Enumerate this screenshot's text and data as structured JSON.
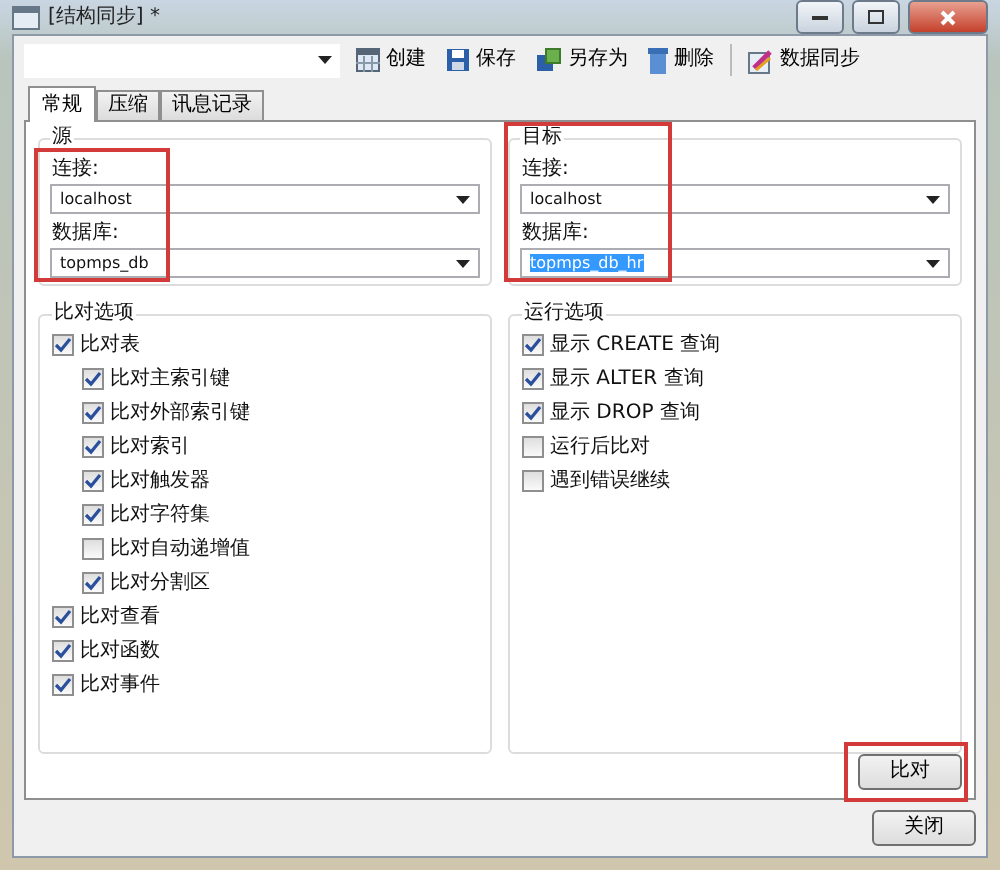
{
  "window": {
    "title": "[结构同步] *"
  },
  "toolbar": {
    "buttons": [
      {
        "label": "创建",
        "kind": "create"
      },
      {
        "label": "保存",
        "kind": "save"
      },
      {
        "label": "另存为",
        "kind": "saveas"
      },
      {
        "label": "删除",
        "kind": "delete"
      },
      {
        "label": "数据同步",
        "kind": "sync"
      }
    ]
  },
  "tabs": [
    {
      "label": "常规",
      "selected": true
    },
    {
      "label": "压缩",
      "selected": false
    },
    {
      "label": "讯息记录",
      "selected": false
    }
  ],
  "source": {
    "title": "源",
    "connection_label": "连接:",
    "connection": "localhost",
    "database_label": "数据库:",
    "database": "topmps_db",
    "database_selected": false
  },
  "target": {
    "title": "目标",
    "connection_label": "连接:",
    "connection": "localhost",
    "database_label": "数据库:",
    "database": "topmps_db_hr",
    "database_selected": true
  },
  "compare_options": {
    "title": "比对选项",
    "items": [
      {
        "label": "比对表",
        "checked": true,
        "children": [
          {
            "label": "比对主索引键",
            "checked": true
          },
          {
            "label": "比对外部索引键",
            "checked": true
          },
          {
            "label": "比对索引",
            "checked": true
          },
          {
            "label": "比对触发器",
            "checked": true
          },
          {
            "label": "比对字符集",
            "checked": true
          },
          {
            "label": "比对自动递增值",
            "checked": false
          },
          {
            "label": "比对分割区",
            "checked": true
          }
        ]
      },
      {
        "label": "比对查看",
        "checked": true
      },
      {
        "label": "比对函数",
        "checked": true
      },
      {
        "label": "比对事件",
        "checked": true
      }
    ]
  },
  "run_options": {
    "title": "运行选项",
    "items": [
      {
        "label": "显示 CREATE 查询",
        "checked": true
      },
      {
        "label": "显示 ALTER 查询",
        "checked": true
      },
      {
        "label": "显示 DROP 查询",
        "checked": true
      },
      {
        "label": "运行后比对",
        "checked": false
      },
      {
        "label": "遇到错误继续",
        "checked": false
      }
    ]
  },
  "compare_button": "比对",
  "close_button": "关闭"
}
